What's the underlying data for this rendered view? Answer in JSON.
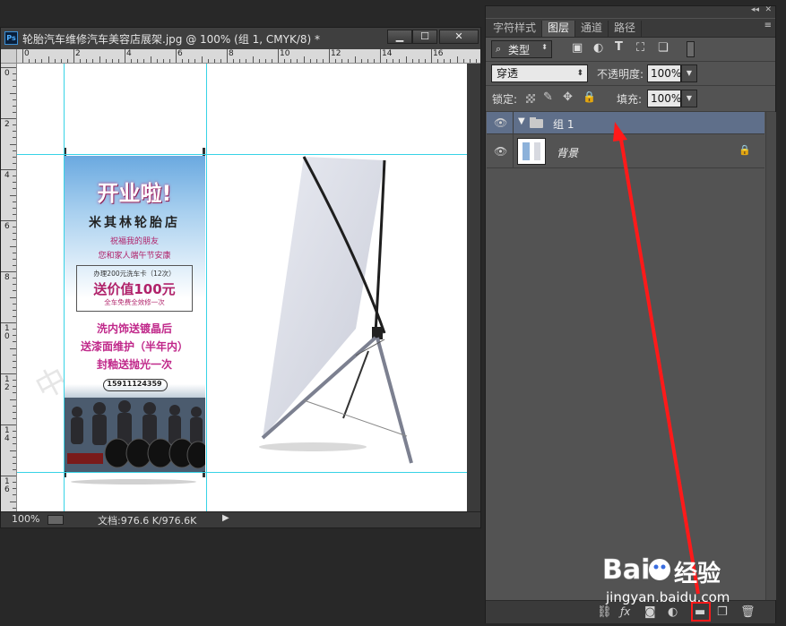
{
  "document": {
    "title": "轮胎汽车维修汽车美容店展架.jpg @ 100% (组 1, CMYK/8) *",
    "ps_badge": "Ps",
    "window_buttons": [
      "▁",
      "☐",
      "✕"
    ],
    "ruler_top_labels": [
      "0",
      "2",
      "4",
      "6",
      "8",
      "10",
      "12",
      "14",
      "16"
    ],
    "ruler_left_labels": [
      "0",
      "2",
      "4",
      "6",
      "8",
      "1\n0",
      "1\n2",
      "1\n4",
      "1\n6"
    ],
    "status": {
      "zoom": "100%",
      "info": "文档:976.6 K/976.6K"
    }
  },
  "banner": {
    "headline": "开业啦!",
    "shop_name": "米其林轮胎店",
    "greeting_1": "祝福我的朋友",
    "greeting_2": "您和家人端午节安康",
    "offer_small": "办理200元洗车卡（12次）",
    "offer_big": "送价值100元",
    "offer_sub": "全车免费全效修一次",
    "promo_1": "洗内饰送镀晶后",
    "promo_2": "送漆面维护（半年内）",
    "promo_3": "封釉送抛光一次",
    "phone": "15911124359"
  },
  "panel": {
    "tabs": [
      {
        "label": "字符样式",
        "active": false
      },
      {
        "label": "图层",
        "active": true
      },
      {
        "label": "通道",
        "active": false
      },
      {
        "label": "路径",
        "active": false
      }
    ],
    "filter_label": "类型",
    "blend_mode": "穿透",
    "opacity_label": "不透明度:",
    "opacity_value": "100%",
    "lock_label": "锁定:",
    "fill_label": "填充:",
    "fill_value": "100%",
    "layers": [
      {
        "name": "组 1",
        "type": "group",
        "selected": true
      },
      {
        "name": "背景",
        "type": "background",
        "selected": false
      }
    ]
  },
  "watermark": {
    "brand": "经验",
    "url": "jingyan.baidu.com"
  },
  "colors": {
    "guide": "#37d3e6",
    "selected_layer": "#5f6f8a",
    "annotation": "#ff1a1a"
  }
}
